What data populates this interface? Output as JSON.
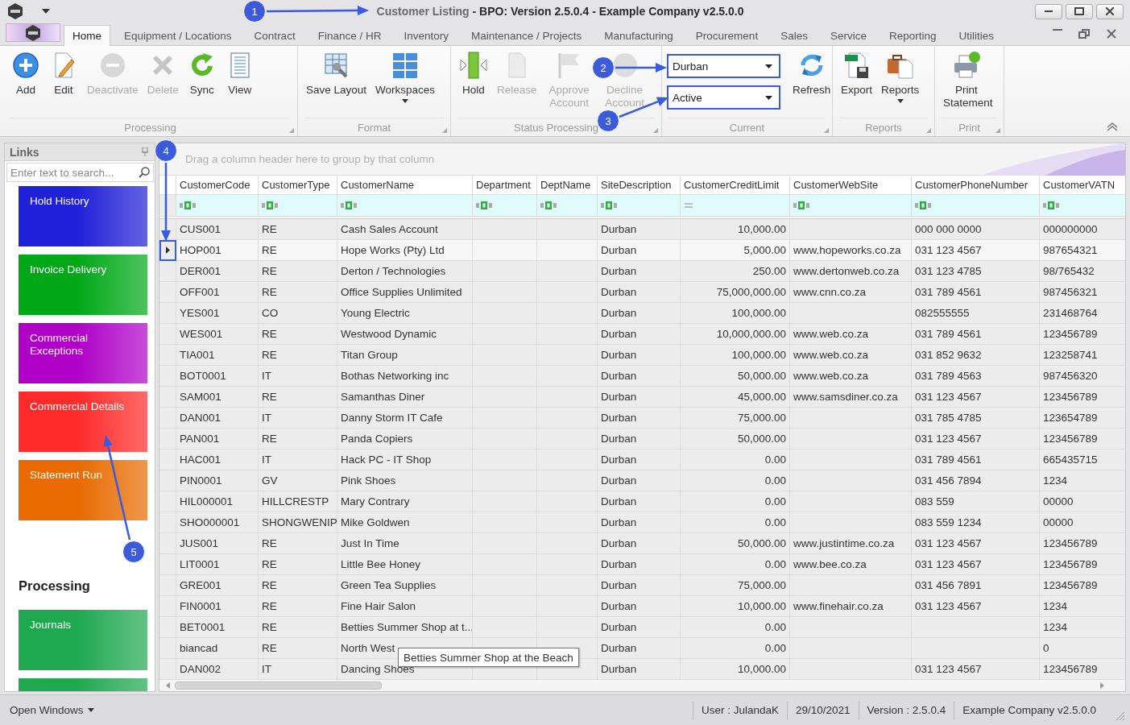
{
  "window": {
    "title_document": "Customer Listing",
    "title_app": "- BPO: Version 2.5.0.4 - Example Company v2.5.0.0"
  },
  "tabs": [
    {
      "label": "Home",
      "selected": true
    },
    {
      "label": "Equipment / Locations",
      "selected": false
    },
    {
      "label": "Contract",
      "selected": false
    },
    {
      "label": "Finance / HR",
      "selected": false
    },
    {
      "label": "Inventory",
      "selected": false
    },
    {
      "label": "Maintenance / Projects",
      "selected": false
    },
    {
      "label": "Manufacturing",
      "selected": false
    },
    {
      "label": "Procurement",
      "selected": false
    },
    {
      "label": "Sales",
      "selected": false
    },
    {
      "label": "Service",
      "selected": false
    },
    {
      "label": "Reporting",
      "selected": false
    },
    {
      "label": "Utilities",
      "selected": false
    }
  ],
  "ribbon": {
    "groups": [
      {
        "label": "Processing",
        "items": [
          {
            "kind": "large",
            "label": "Add",
            "disabled": false
          },
          {
            "kind": "large",
            "label": "Edit",
            "disabled": false
          },
          {
            "kind": "large",
            "label": "Deactivate",
            "disabled": true
          },
          {
            "kind": "large",
            "label": "Delete",
            "disabled": true
          },
          {
            "kind": "large",
            "label": "Sync",
            "disabled": false
          },
          {
            "kind": "large",
            "label": "View",
            "disabled": false
          }
        ]
      },
      {
        "label": "Format",
        "items": [
          {
            "kind": "large",
            "label": "Save Layout",
            "disabled": false
          },
          {
            "kind": "menu",
            "label": "Workspaces",
            "disabled": false
          }
        ]
      },
      {
        "label": "Status Processing",
        "items": [
          {
            "kind": "large",
            "label": "Hold",
            "disabled": false
          },
          {
            "kind": "large",
            "label": "Release",
            "disabled": true
          },
          {
            "kind": "large",
            "label": "Approve Account",
            "disabled": true
          },
          {
            "kind": "large",
            "label": "Decline Account",
            "disabled": true
          }
        ]
      },
      {
        "label": "Current",
        "items": [
          {
            "kind": "combos",
            "fields": [
              {
                "value": "Durban"
              },
              {
                "value": "Active"
              }
            ]
          },
          {
            "kind": "large",
            "label": "Refresh",
            "disabled": false
          }
        ]
      },
      {
        "label": "Reports",
        "items": [
          {
            "kind": "large",
            "label": "Export",
            "disabled": false
          },
          {
            "kind": "menu",
            "label": "Reports",
            "disabled": false
          }
        ]
      },
      {
        "label": "Print",
        "items": [
          {
            "kind": "large",
            "label": "Print Statement",
            "disabled": false
          }
        ]
      }
    ]
  },
  "links": {
    "title": "Links",
    "search_placeholder": "Enter text to search...",
    "sections": [
      {
        "tiles": [
          {
            "label": "Hold History",
            "color": "#2020d8"
          },
          {
            "label": "Invoice Delivery",
            "color": "#00a818"
          },
          {
            "label": "Commercial Exceptions",
            "color": "#b000c8"
          },
          {
            "label": "Commercial Details",
            "color": "#ff2a2a"
          },
          {
            "label": "Statement Run",
            "color": "#e86a00"
          }
        ]
      },
      {
        "heading": "Processing",
        "tiles": [
          {
            "label": "Journals",
            "color": "#20a850"
          },
          {
            "color": "#20a850"
          }
        ]
      }
    ]
  },
  "grid": {
    "group_hint": "Drag a column header here to group by that column",
    "columns": [
      {
        "label": "CustomerCode",
        "kind": "text"
      },
      {
        "label": "CustomerType",
        "kind": "text"
      },
      {
        "label": "CustomerName",
        "kind": "text"
      },
      {
        "label": "Department",
        "kind": "text"
      },
      {
        "label": "DeptName",
        "kind": "text"
      },
      {
        "label": "SiteDescription",
        "kind": "text"
      },
      {
        "label": "CustomerCreditLimit",
        "kind": "number"
      },
      {
        "label": "CustomerWebSite",
        "kind": "text"
      },
      {
        "label": "CustomerPhoneNumber",
        "kind": "text"
      },
      {
        "label": "CustomerVATN",
        "kind": "text"
      }
    ],
    "rows": [
      {
        "selected": false,
        "cells": [
          "CUS001",
          "RE",
          "Cash Sales Account",
          null,
          null,
          "Durban",
          "10,000.00",
          null,
          "000 000 0000",
          "000000000"
        ]
      },
      {
        "selected": true,
        "cells": [
          "HOP001",
          "RE",
          "Hope Works (Pty) Ltd",
          null,
          null,
          "Durban",
          "5,000.00",
          "www.hopeworks.co.za",
          "031 123 4567",
          "987654321"
        ]
      },
      {
        "selected": false,
        "cells": [
          "DER001",
          "RE",
          "Derton / Technologies",
          null,
          null,
          "Durban",
          "250.00",
          "www.dertonweb.co.za",
          "031 123 4785",
          "98/765432"
        ]
      },
      {
        "selected": false,
        "cells": [
          "OFF001",
          "RE",
          "Office Supplies Unlimited",
          null,
          null,
          "Durban",
          "75,000,000.00",
          "www.cnn.co.za",
          "031 789 4561",
          "987456321"
        ]
      },
      {
        "selected": false,
        "cells": [
          "YES001",
          "CO",
          "Young Electric",
          null,
          null,
          "Durban",
          "100,000.00",
          null,
          "082555555",
          "231468764"
        ]
      },
      {
        "selected": false,
        "cells": [
          "WES001",
          "RE",
          "Westwood Dynamic",
          null,
          null,
          "Durban",
          "10,000,000.00",
          "www.web.co.za",
          "031 789 4561",
          "123456789"
        ]
      },
      {
        "selected": false,
        "cells": [
          "TIA001",
          "RE",
          "Titan Group",
          null,
          null,
          "Durban",
          "100,000.00",
          "www.web.co.za",
          "031 852 9632",
          "123258741"
        ]
      },
      {
        "selected": false,
        "cells": [
          "BOT0001",
          "IT",
          "Bothas Networking inc",
          null,
          null,
          "Durban",
          "50,000.00",
          "www.web.co.za",
          "031 789 4563",
          "987456320"
        ]
      },
      {
        "selected": false,
        "cells": [
          "SAM001",
          "RE",
          "Samanthas Diner",
          null,
          null,
          "Durban",
          "45,000.00",
          "www.samsdiner.co.za",
          "031 123 4567",
          "123456789"
        ]
      },
      {
        "selected": false,
        "cells": [
          "DAN001",
          "IT",
          "Danny Storm IT Cafe",
          null,
          null,
          "Durban",
          "75,000.00",
          null,
          "031 785 4785",
          "123654789"
        ]
      },
      {
        "selected": false,
        "cells": [
          "PAN001",
          "RE",
          "Panda Copiers",
          null,
          null,
          "Durban",
          "50,000.00",
          null,
          "031 123 4567",
          "123456789"
        ]
      },
      {
        "selected": false,
        "cells": [
          "HAC001",
          "IT",
          "Hack PC - IT Shop",
          null,
          null,
          "Durban",
          "0.00",
          null,
          "031 789 4561",
          "665435715"
        ]
      },
      {
        "selected": false,
        "cells": [
          "PIN0001",
          "GV",
          "Pink Shoes",
          null,
          null,
          "Durban",
          "0.00",
          null,
          "031 456 7894",
          "1234"
        ]
      },
      {
        "selected": false,
        "cells": [
          "HIL000001",
          "HILLCRESTP",
          "Mary Contrary",
          null,
          null,
          "Durban",
          "0.00",
          null,
          "083 559",
          "00000"
        ]
      },
      {
        "selected": false,
        "cells": [
          "SHO000001",
          "SHONGWENIP",
          "Mike Goldwen",
          null,
          null,
          "Durban",
          "0.00",
          null,
          "083 559 1234",
          "00000"
        ]
      },
      {
        "selected": false,
        "cells": [
          "JUS001",
          "RE",
          "Just In Time",
          null,
          null,
          "Durban",
          "50,000.00",
          "www.justintime.co.za",
          "031 123 4567",
          "123456789"
        ]
      },
      {
        "selected": false,
        "cells": [
          "LIT0001",
          "RE",
          "Little Bee Honey",
          null,
          null,
          "Durban",
          "0.00",
          "www.bee.co.za",
          "031 123 4567",
          "123456789"
        ]
      },
      {
        "selected": false,
        "cells": [
          "GRE001",
          "RE",
          "Green Tea Supplies",
          null,
          null,
          "Durban",
          "75,000.00",
          null,
          "031 456 7891",
          "123456789"
        ]
      },
      {
        "selected": false,
        "cells": [
          "FIN0001",
          "RE",
          "Fine Hair Salon",
          null,
          null,
          "Durban",
          "10,000.00",
          "www.finehair.co.za",
          "031 123 4567",
          "1234"
        ]
      },
      {
        "selected": false,
        "cells": [
          "BET0001",
          "RE",
          "Betties Summer Shop at t...",
          null,
          null,
          "Durban",
          "0.00",
          null,
          null,
          "1234"
        ]
      },
      {
        "selected": false,
        "cells": [
          "biancad",
          "RE",
          "North West",
          null,
          null,
          "Durban",
          "0.00",
          null,
          null,
          "0"
        ]
      },
      {
        "selected": false,
        "cells": [
          "DAN002",
          "IT",
          "Dancing Shoes",
          null,
          null,
          "Durban",
          "10,000.00",
          null,
          "031 123 4567",
          "123456789"
        ]
      }
    ],
    "tooltip": "Betties Summer Shop at the Beach"
  },
  "status_bar": {
    "open_windows": "Open Windows",
    "items": [
      "User : JulandaK",
      "29/10/2021",
      "Version : 2.5.0.4",
      "Example Company v2.5.0.0"
    ]
  },
  "callouts": [
    {
      "number": "1"
    },
    {
      "number": "2"
    },
    {
      "number": "3"
    },
    {
      "number": "4"
    },
    {
      "number": "5"
    }
  ]
}
